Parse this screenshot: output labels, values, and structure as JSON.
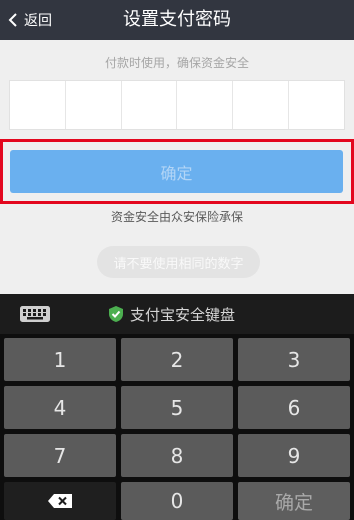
{
  "header": {
    "back_label": "返回",
    "title": "设置支付密码"
  },
  "password": {
    "hint": "付款时使用，确保资金安全",
    "digits": 6
  },
  "confirm": {
    "label": "确定",
    "highlight_color": "#e3071e",
    "color": "#6ab0ef"
  },
  "insurance_text": "资金安全由众安保险承保",
  "tip_text": "请不要使用相同的数字",
  "keyboard": {
    "title": "支付宝安全键盘",
    "shield_color": "#4caf50",
    "keys": [
      "1",
      "2",
      "3",
      "4",
      "5",
      "6",
      "7",
      "8",
      "9",
      "0"
    ],
    "ok_label": "确定",
    "icons": [
      "keyboard-icon",
      "shield-check-icon",
      "backspace-icon",
      "chevron-left-icon"
    ]
  }
}
